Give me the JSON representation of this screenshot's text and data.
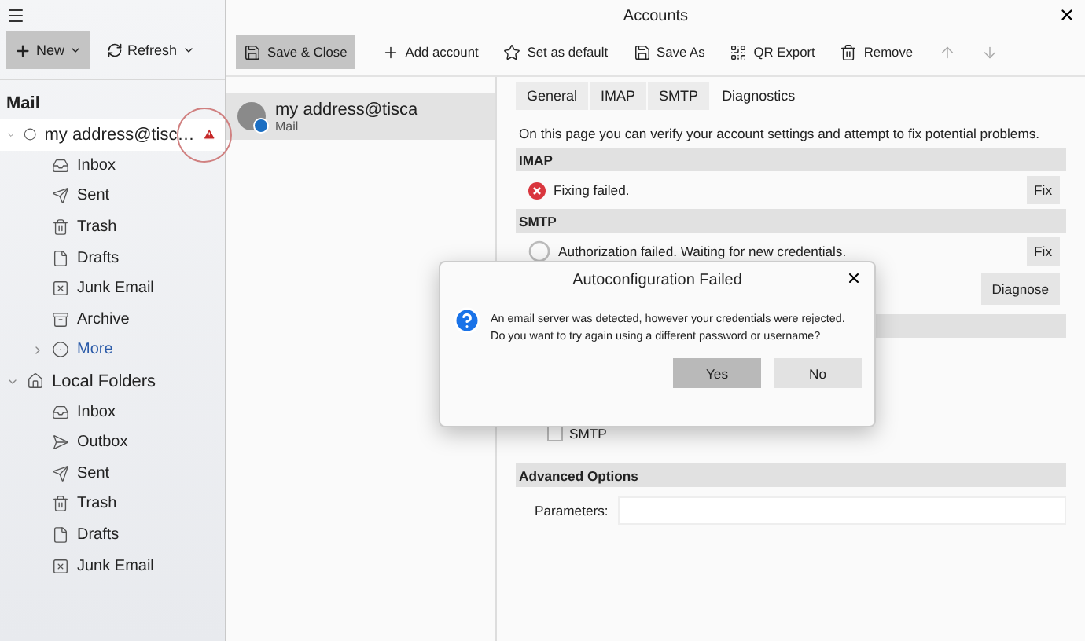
{
  "sidebar": {
    "toolbar": [
      {
        "kind": "new",
        "label": "New",
        "pressed": true
      },
      {
        "kind": "refresh",
        "label": "Refresh",
        "pressed": false
      }
    ],
    "heading": "Mail",
    "tree": [
      {
        "label": "my address@tisc…",
        "kind": "account",
        "expanded": true,
        "selected": true,
        "warning": true,
        "children": [
          {
            "label": "Inbox",
            "kind": "inbox",
            "selected": false
          },
          {
            "label": "Sent",
            "kind": "sent",
            "selected": false
          },
          {
            "label": "Trash",
            "kind": "trash",
            "selected": false
          },
          {
            "label": "Drafts",
            "kind": "drafts",
            "selected": false
          },
          {
            "label": "Junk Email",
            "kind": "junk",
            "selected": false
          },
          {
            "label": "Archive",
            "kind": "archive",
            "selected": false
          },
          {
            "label": "More",
            "kind": "more",
            "selected": false,
            "expanded": false
          }
        ]
      },
      {
        "label": "Local Folders",
        "kind": "home",
        "expanded": true,
        "selected": false,
        "children": [
          {
            "label": "Inbox",
            "kind": "inbox",
            "selected": false
          },
          {
            "label": "Outbox",
            "kind": "outbox",
            "selected": false
          },
          {
            "label": "Sent",
            "kind": "sent",
            "selected": false
          },
          {
            "label": "Trash",
            "kind": "trash",
            "selected": false
          },
          {
            "label": "Drafts",
            "kind": "drafts",
            "selected": false
          },
          {
            "label": "Junk Email",
            "kind": "junk",
            "selected": false
          }
        ]
      }
    ]
  },
  "window": {
    "title": "Accounts",
    "toolbar": [
      {
        "kind": "save",
        "label": "Save & Close",
        "pressed": true,
        "disabled": false
      },
      {
        "kind": "add",
        "label": "Add account",
        "pressed": false,
        "disabled": false
      },
      {
        "kind": "star",
        "label": "Set as default",
        "pressed": false,
        "disabled": false
      },
      {
        "kind": "save",
        "label": "Save As",
        "pressed": false,
        "disabled": false
      },
      {
        "kind": "qr",
        "label": "QR Export",
        "pressed": false,
        "disabled": false
      },
      {
        "kind": "remove",
        "label": "Remove",
        "pressed": false,
        "disabled": false
      },
      {
        "kind": "up",
        "pressed": false,
        "disabled": true
      },
      {
        "kind": "down",
        "pressed": false,
        "disabled": true
      }
    ],
    "accounts": [
      {
        "name": "my address@tisca",
        "type": "Mail",
        "selected": true
      }
    ],
    "tabs": [
      {
        "label": "General",
        "selected": false
      },
      {
        "label": "IMAP",
        "selected": false
      },
      {
        "label": "SMTP",
        "selected": false
      },
      {
        "label": "Diagnostics",
        "selected": true
      }
    ],
    "intro": "On this page you can verify your account settings and attempt to fix potential problems.",
    "sections": [
      {
        "header": "IMAP",
        "kind": "error",
        "message": "Fixing failed.",
        "button": "Fix"
      },
      {
        "header": "SMTP",
        "kind": "busy",
        "message": "Authorization failed. Waiting for new credentials.",
        "button": "Fix"
      }
    ],
    "diagnose_button": "Diagnose",
    "checkbox": {
      "label": "SMTP",
      "checked": false
    },
    "advanced": {
      "header": "Advanced Options",
      "label": "Parameters:"
    }
  },
  "dialog": {
    "title": "Autoconfiguration Failed",
    "messages": [
      "An email server was detected, however your credentials were rejected.",
      "Do you want to try again using a different password or username?"
    ],
    "buttons": [
      {
        "label": "Yes",
        "default": true
      },
      {
        "label": "No",
        "default": false
      }
    ]
  }
}
